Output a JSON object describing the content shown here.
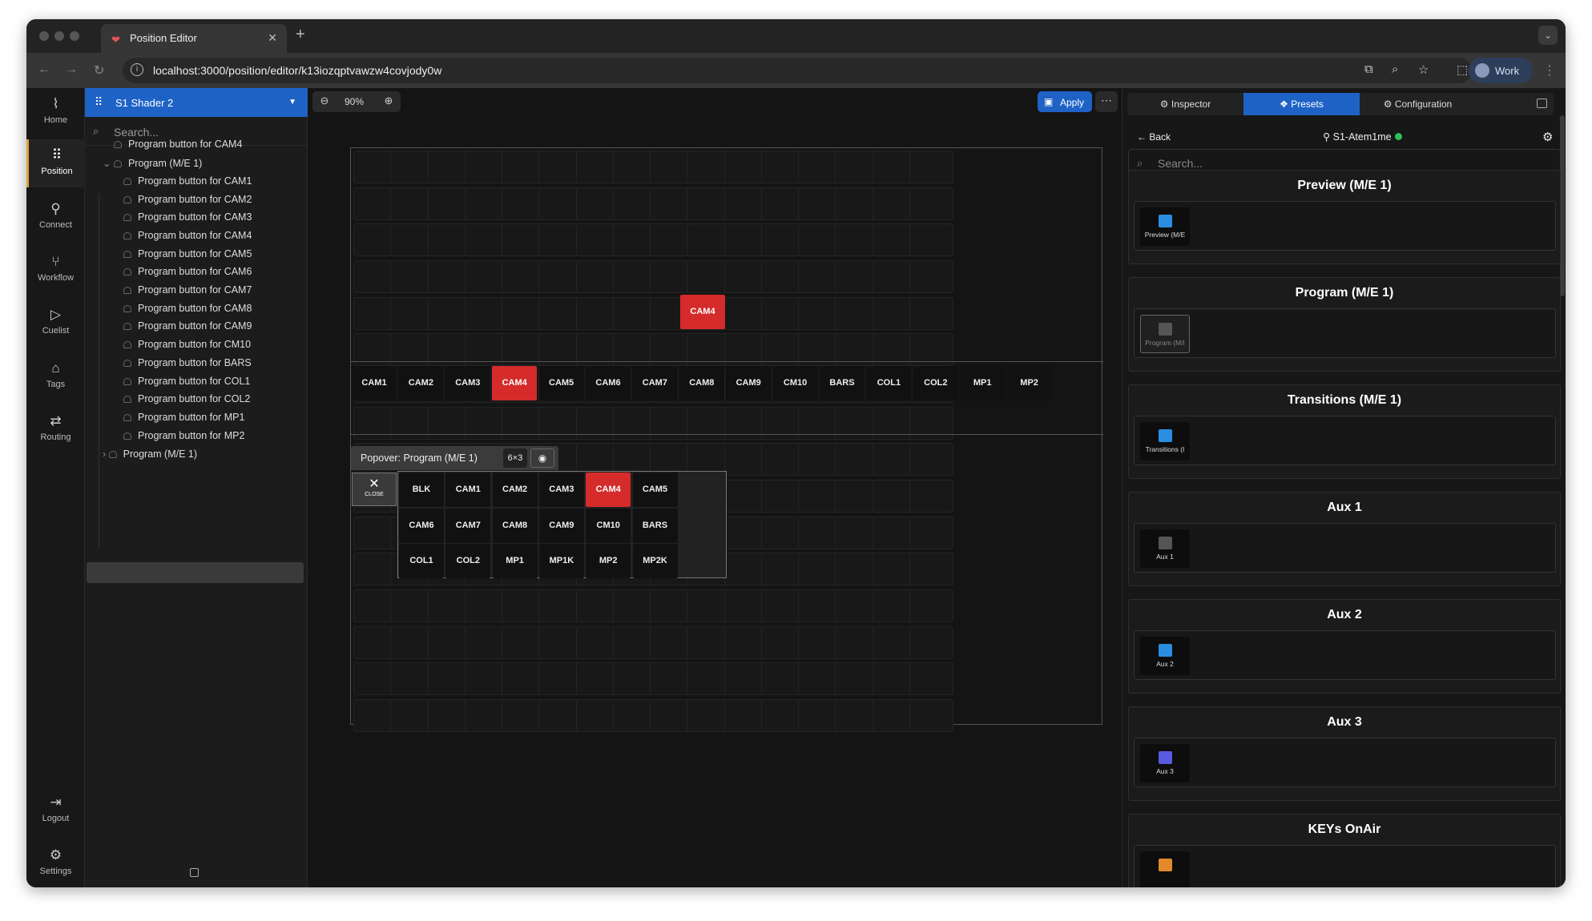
{
  "browser": {
    "tab_title": "Position Editor",
    "url": "localhost:3000/position/editor/k13iozqptvawzw4covjody0w",
    "profile": "Work"
  },
  "sidebar": {
    "items": [
      {
        "label": "Home",
        "icon": "pulse-icon",
        "glyph": "⌇"
      },
      {
        "label": "Position",
        "icon": "grid-icon",
        "glyph": "⠿"
      },
      {
        "label": "Connect",
        "icon": "plug-icon",
        "glyph": "⚲"
      },
      {
        "label": "Workflow",
        "icon": "workflow-icon",
        "glyph": "⑂"
      },
      {
        "label": "Cuelist",
        "icon": "play-icon",
        "glyph": "▷"
      },
      {
        "label": "Tags",
        "icon": "tag-icon",
        "glyph": "⌂"
      },
      {
        "label": "Routing",
        "icon": "routing-icon",
        "glyph": "⇄"
      }
    ],
    "bottom": [
      {
        "label": "Logout",
        "icon": "logout-icon",
        "glyph": "⇥"
      },
      {
        "label": "Settings",
        "icon": "settings-icon",
        "glyph": "⚙"
      }
    ]
  },
  "tree": {
    "shader": "S1 Shader 2",
    "search_placeholder": "Search...",
    "items": [
      "Program button for CAM4",
      "Program (M/E 1)",
      "Program button for CAM1",
      "Program button for CAM2",
      "Program button for CAM3",
      "Program button for CAM4",
      "Program button for CAM5",
      "Program button for CAM6",
      "Program button for CAM7",
      "Program button for CAM8",
      "Program button for CAM9",
      "Program button for CM10",
      "Program button for BARS",
      "Program button for COL1",
      "Program button for COL2",
      "Program button for MP1",
      "Program button for MP2",
      "Program (M/E 1)"
    ]
  },
  "canvas": {
    "zoom": "90%",
    "apply_label": "Apply",
    "floating_button": "CAM4",
    "row_buttons": [
      "CAM1",
      "CAM2",
      "CAM3",
      "CAM4",
      "CAM5",
      "CAM6",
      "CAM7",
      "CAM8",
      "CAM9",
      "CM10",
      "BARS",
      "COL1",
      "COL2",
      "MP1",
      "MP2"
    ],
    "highlight_color": "#d52b2b",
    "popover": {
      "title": "Popover: Program (M/E 1)",
      "size": "6×3",
      "close_label": "CLOSE",
      "buttons": [
        "BLK",
        "CAM1",
        "CAM2",
        "CAM3",
        "CAM4",
        "CAM5",
        "CAM6",
        "CAM7",
        "CAM8",
        "CAM9",
        "CM10",
        "BARS",
        "COL1",
        "COL2",
        "MP1",
        "MP1K",
        "MP2",
        "MP2K"
      ]
    }
  },
  "panel": {
    "tabs": [
      "Inspector",
      "Presets",
      "Configuration"
    ],
    "active_tab": "Presets",
    "back_label": "Back",
    "device": "S1-Atem1me",
    "search_placeholder": "Search...",
    "sections": [
      {
        "title": "Preview (M/E 1)",
        "tile": "Preview (M/E",
        "color": "#2a8ee0"
      },
      {
        "title": "Program (M/E 1)",
        "tile": "Program (M/I",
        "color": "#555555"
      },
      {
        "title": "Transitions (M/E 1)",
        "tile": "Transitions (I",
        "color": "#2a8ee0"
      },
      {
        "title": "Aux 1",
        "tile": "Aux 1",
        "color": "#555555"
      },
      {
        "title": "Aux 2",
        "tile": "Aux 2",
        "color": "#2a8ee0"
      },
      {
        "title": "Aux 3",
        "tile": "Aux 3",
        "color": "#5a5ae0"
      },
      {
        "title": "KEYs OnAir",
        "tile": "",
        "color": "#e08a2a"
      }
    ]
  }
}
